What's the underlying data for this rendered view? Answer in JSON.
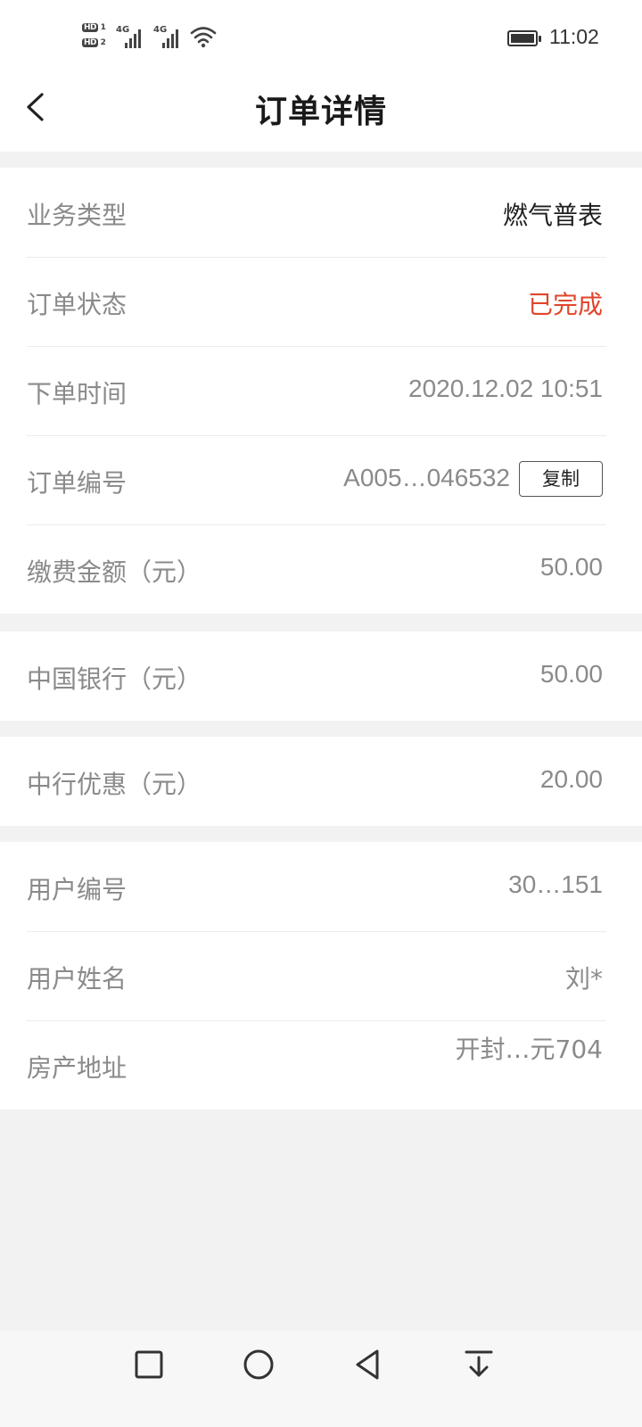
{
  "status_bar": {
    "sim1_badge": "HD",
    "sim1_index": "1",
    "sim2_badge": "HD",
    "sim2_index": "2",
    "network1": "4G",
    "network2": "4G",
    "time": "11:02",
    "icons": [
      "signal-icon",
      "wifi-icon",
      "battery-icon"
    ]
  },
  "header": {
    "title": "订单详情",
    "back_icon": "chevron-left-icon"
  },
  "order": {
    "business_type": {
      "label": "业务类型",
      "value": "燃气普表"
    },
    "status": {
      "label": "订单状态",
      "value": "已完成",
      "color": "#e0452b"
    },
    "order_time": {
      "label": "下单时间",
      "value": "2020.12.02 10:51"
    },
    "order_number": {
      "label": "订单编号",
      "value": "A005…046532",
      "copy_label": "复制"
    },
    "payment_amount": {
      "label": "缴费金额（元）",
      "value": "50.00"
    }
  },
  "bank": {
    "boc": {
      "label": "中国银行（元）",
      "value": "50.00"
    }
  },
  "discount": {
    "boc_discount": {
      "label": "中行优惠（元）",
      "value": "20.00"
    }
  },
  "user": {
    "user_number": {
      "label": "用户编号",
      "value": "30…151"
    },
    "user_name": {
      "label": "用户姓名",
      "value": "刘*"
    },
    "address": {
      "label": "房产地址",
      "value": "开封…元704"
    }
  },
  "nav_bar": {
    "icons": [
      "recents-square-icon",
      "home-circle-icon",
      "back-triangle-icon",
      "notification-pulldown-icon"
    ]
  },
  "colors": {
    "accent_red": "#e0452b",
    "background": "#f2f2f2",
    "card": "#ffffff"
  }
}
